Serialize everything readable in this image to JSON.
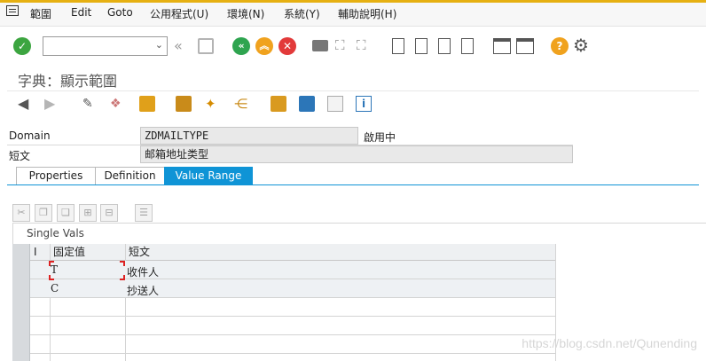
{
  "menu": {
    "items": [
      "範圍",
      "Edit",
      "Goto",
      "公用程式(U)",
      "環境(N)",
      "系統(Y)",
      "輔助說明(H)"
    ]
  },
  "toolbar": {
    "command_field_value": "",
    "icons": [
      "enter-icon",
      "back-nav-icon",
      "save-icon",
      "back-icon",
      "exit-icon",
      "cancel-icon",
      "print-icon",
      "find-icon",
      "find-next-icon",
      "first-page-icon",
      "previous-page-icon",
      "next-page-icon",
      "last-page-icon",
      "new-session-icon",
      "shortcut-icon",
      "help-icon",
      "settings-icon"
    ]
  },
  "page": {
    "title": "字典：顯示範圍"
  },
  "fields": {
    "domain_label": "Domain",
    "domain_value": "ZDMAILTYPE",
    "domain_status": "啟用中",
    "short_text_label": "短文",
    "short_text_value": "邮箱地址类型"
  },
  "tabs": [
    {
      "label": "Properties",
      "active": false
    },
    {
      "label": "Definition",
      "active": false
    },
    {
      "label": "Value Range",
      "active": true
    }
  ],
  "table": {
    "caption": "Single Vals",
    "columns": [
      "I",
      "固定值",
      "短文"
    ],
    "rows": [
      {
        "fixed_value": "T",
        "short_text": "收件人"
      },
      {
        "fixed_value": "C",
        "short_text": "抄送人"
      }
    ]
  },
  "watermark": "https://blog.csdn.net/Qunending",
  "colors": {
    "accent": "#0f94d6",
    "menu_border": "#e6b012",
    "enter_green": "#3ca540",
    "back_green": "#2ea44f",
    "exit_orange": "#f0a21e",
    "cancel_red": "#e23a3a"
  }
}
